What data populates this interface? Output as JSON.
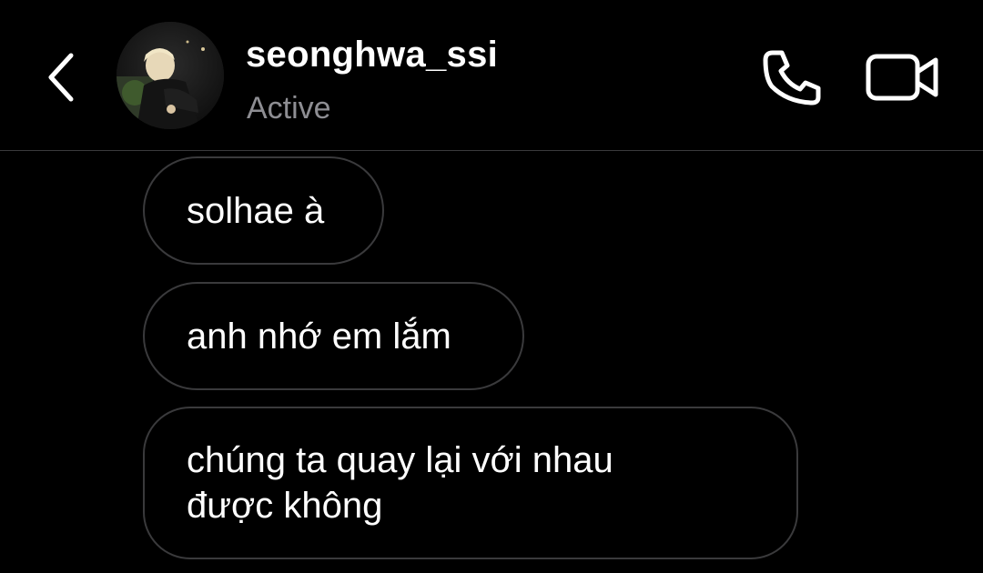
{
  "header": {
    "back_icon": "chevron-left-icon",
    "username": "seonghwa_ssi",
    "status": "Active",
    "call_icon": "phone-icon",
    "video_icon": "video-camera-icon"
  },
  "messages": [
    {
      "text": "solhae à"
    },
    {
      "text": "anh nhớ em lắm"
    },
    {
      "text": "chúng ta quay lại với nhau được không"
    }
  ],
  "colors": {
    "background": "#000000",
    "bubble_border": "#3a3a3c",
    "status_text": "#8e8e93",
    "text": "#ffffff"
  }
}
